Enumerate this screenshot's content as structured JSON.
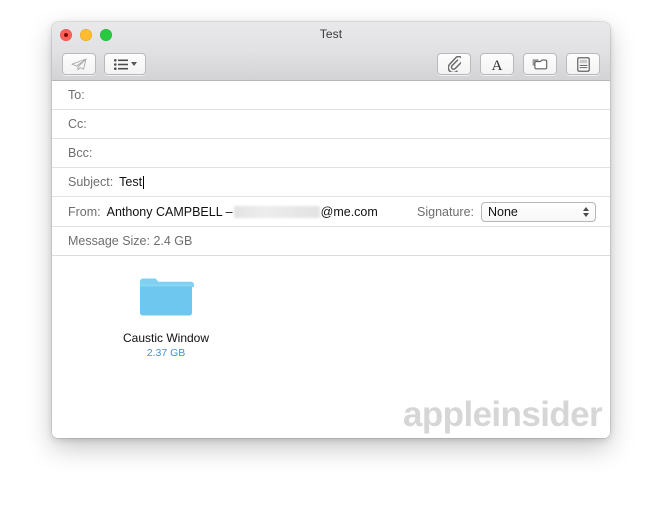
{
  "window": {
    "title": "Test",
    "traffic_lights": [
      "close",
      "minimize",
      "zoom"
    ]
  },
  "toolbar": {
    "left_buttons": [
      {
        "name": "send-button",
        "icon": "paper-plane-icon",
        "label": ""
      },
      {
        "name": "header-fields-button",
        "icon": "list-icon",
        "label": ""
      }
    ],
    "right_buttons": [
      {
        "name": "attach-button",
        "icon": "paperclip-icon",
        "label": ""
      },
      {
        "name": "format-button",
        "icon": "letter-a-icon",
        "label": "A"
      },
      {
        "name": "photo-browser-button",
        "icon": "photo-browser-icon",
        "label": ""
      },
      {
        "name": "stationery-button",
        "icon": "stationery-icon",
        "label": ""
      }
    ]
  },
  "headers": {
    "to": {
      "label": "To:",
      "value": ""
    },
    "cc": {
      "label": "Cc:",
      "value": ""
    },
    "bcc": {
      "label": "Bcc:",
      "value": ""
    },
    "subject": {
      "label": "Subject:",
      "value": "Test"
    },
    "from": {
      "label": "From:",
      "display_name": "Anthony CAMPBELL –",
      "email_redacted": true,
      "email_suffix": "@me.com"
    },
    "signature": {
      "label": "Signature:",
      "selected": "None",
      "options": [
        "None"
      ]
    },
    "message_size": {
      "label": "Message Size:",
      "value": "2.4 GB",
      "full_text": "Message Size: 2.4 GB"
    }
  },
  "body": {
    "attachments": [
      {
        "icon": "folder-icon",
        "name": "Caustic Window",
        "size": "2.37 GB",
        "icon_color": "#6ec7ef"
      }
    ],
    "watermark": "appleinsider"
  },
  "colors": {
    "accent_blue": "#4a8fd4",
    "folder_blue": "#6ec7ef",
    "watermark_gray": "#d6d6d6",
    "label_gray": "#6e6e6e",
    "toolbar_top": "#e3e3e5",
    "toolbar_bottom": "#d3d3d6"
  }
}
